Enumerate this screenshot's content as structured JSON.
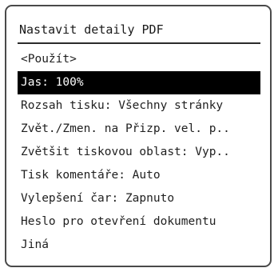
{
  "panel": {
    "title": "Nastavit detaily PDF",
    "items": [
      {
        "label": "<Použít>",
        "selected": false
      },
      {
        "label": "Jas: 100%",
        "selected": true
      },
      {
        "label": "Rozsah tisku: Všechny stránky",
        "selected": false
      },
      {
        "label": "Zvět./Zmen. na Přizp. vel. p..",
        "selected": false
      },
      {
        "label": "Zvětšit tiskovou oblast: Vyp..",
        "selected": false
      },
      {
        "label": "Tisk komentáře: Auto",
        "selected": false
      },
      {
        "label": "Vylepšení čar: Zapnuto",
        "selected": false
      },
      {
        "label": "Heslo pro otevření dokumentu",
        "selected": false
      },
      {
        "label": "Jiná",
        "selected": false
      }
    ]
  },
  "colors": {
    "selected_background": "#000000",
    "selected_text": "#ffffff",
    "text": "#1f1f1f",
    "border": "#4a4a4a"
  }
}
